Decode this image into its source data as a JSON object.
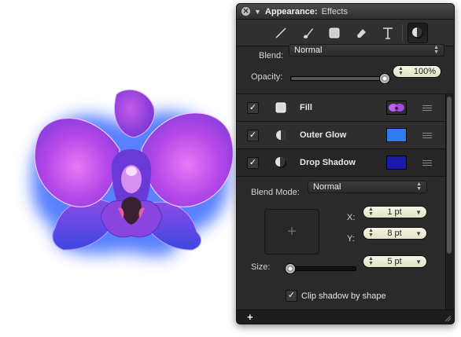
{
  "panel": {
    "title": "Appearance:",
    "subtitle": "Effects",
    "blend_label": "Blend:",
    "blend_value": "Normal",
    "opacity_label": "Opacity:",
    "opacity_value": "100%",
    "opacity_level": 1.0
  },
  "toolbar": {
    "tools": [
      "line-icon",
      "brush-icon",
      "fill-square-icon",
      "eraser-icon",
      "text-icon",
      "shadow-effects-icon"
    ],
    "active": "shadow-effects-icon"
  },
  "effects": [
    {
      "name": "Fill",
      "checked": true,
      "swatch": "#8a3fd8"
    },
    {
      "name": "Outer Glow",
      "checked": true,
      "swatch": "#2f7bf0"
    },
    {
      "name": "Drop Shadow",
      "checked": true,
      "swatch": "#1a1aa8"
    }
  ],
  "shadow": {
    "blend_mode_label": "Blend Mode:",
    "blend_mode_value": "Normal",
    "x_label": "X:",
    "x_value": "1 pt",
    "y_label": "Y:",
    "y_value": "8 pt",
    "size_label": "Size:",
    "size_value": "5 pt",
    "size_level": 0.05,
    "clip_label": "Clip shadow by shape",
    "clip_checked": true
  },
  "colors": {
    "panel_bg": "#2a2a2a",
    "glow": "#3b6bff",
    "petal": "#b63ee6"
  }
}
